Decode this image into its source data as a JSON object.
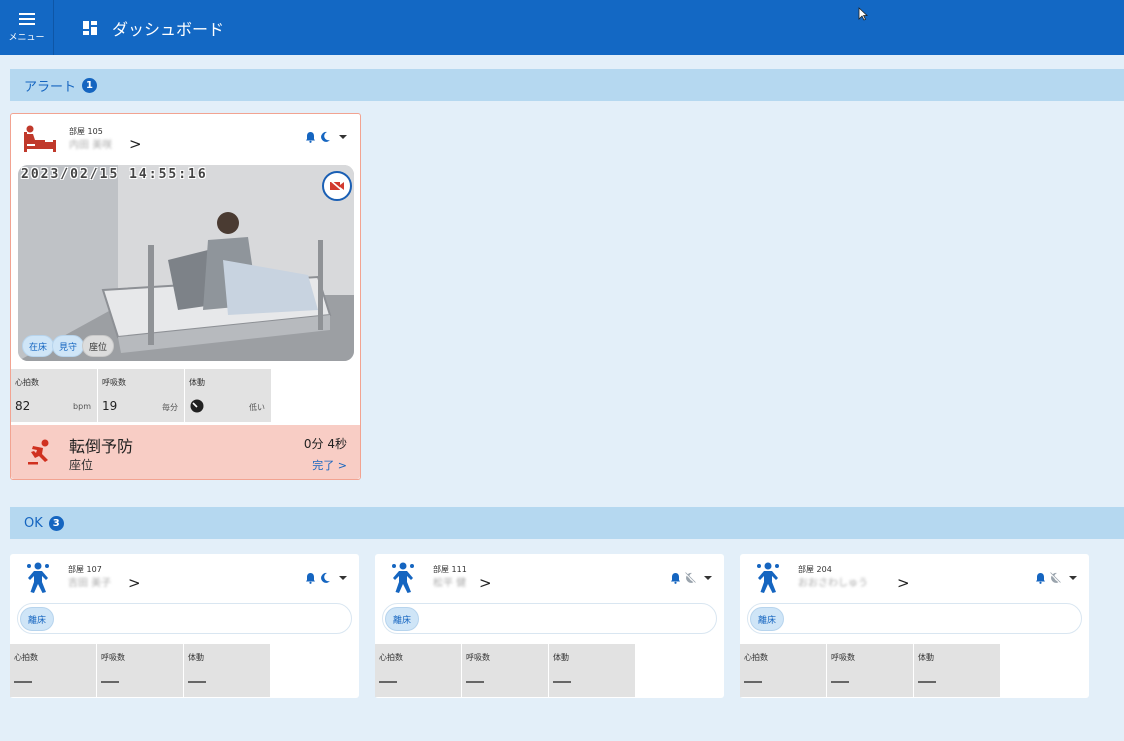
{
  "header": {
    "menu_label": "メニュー",
    "title": "ダッシュボード"
  },
  "sections": {
    "alert": {
      "label": "アラート",
      "count": "1"
    },
    "ok": {
      "label": "OK",
      "count": "3"
    }
  },
  "alert_card": {
    "room_label": "部屋 105",
    "room_name": "内田 美咲",
    "chevron": ">",
    "timestamp": "2023/02/15  14:55:16",
    "chips": [
      "在床",
      "見守",
      "座位"
    ],
    "vitals": [
      {
        "label": "心拍数",
        "value": "82",
        "unit": "bpm"
      },
      {
        "label": "呼吸数",
        "value": "19",
        "unit": "毎分"
      },
      {
        "label": "体動",
        "value": "",
        "unit": "低い"
      }
    ],
    "alert": {
      "title": "転倒予防",
      "subtitle": "座位",
      "elapsed": "0分 4秒",
      "done_label": "完了 >"
    },
    "colors": {
      "alert_bg": "#f8cdc5",
      "bed_icon": "#c0392b"
    }
  },
  "ok_cards": [
    {
      "room_label": "部屋 107",
      "room_name": "吉田 美子",
      "chevron": ">",
      "status": "離床",
      "sleep_state": "moon-icon",
      "vitals": [
        {
          "label": "心拍数"
        },
        {
          "label": "呼吸数"
        },
        {
          "label": "体動"
        }
      ]
    },
    {
      "room_label": "部屋 111",
      "room_name": "松平 健",
      "chevron": ">",
      "status": "離床",
      "sleep_state": "moon-off-icon",
      "vitals": [
        {
          "label": "心拍数"
        },
        {
          "label": "呼吸数"
        },
        {
          "label": "体動"
        }
      ]
    },
    {
      "room_label": "部屋 204",
      "room_name": "おおさわしゅう",
      "chevron": ">",
      "status": "離床",
      "sleep_state": "moon-off-icon",
      "vitals": [
        {
          "label": "心拍数"
        },
        {
          "label": "呼吸数"
        },
        {
          "label": "体動"
        }
      ]
    }
  ],
  "colors": {
    "header": "#1368c4",
    "background": "#e3eff9",
    "section_bar": "#b5d8f0",
    "accent": "#1565c0"
  }
}
